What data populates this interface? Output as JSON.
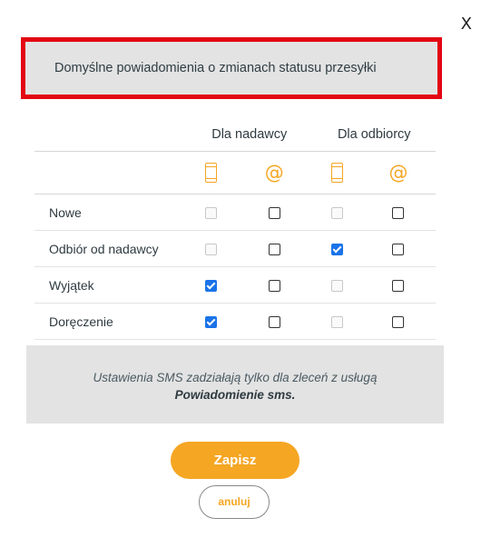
{
  "dialog": {
    "close_label": "X",
    "title": "Domyślne powiadomienia o zmianach statusu przesyłki"
  },
  "table": {
    "groups": [
      {
        "label": "Dla nadawcy"
      },
      {
        "label": "Dla odbiorcy"
      }
    ],
    "channel_icons": [
      "phone-icon",
      "at-icon",
      "phone-icon",
      "at-icon"
    ],
    "at_symbol": "@",
    "rows": [
      {
        "label": "Nowe",
        "states": [
          "disabled",
          "unchecked",
          "disabled",
          "unchecked"
        ]
      },
      {
        "label": "Odbiór od nadawcy",
        "states": [
          "disabled",
          "unchecked",
          "checked",
          "unchecked"
        ]
      },
      {
        "label": "Wyjątek",
        "states": [
          "checked",
          "unchecked",
          "disabled",
          "unchecked"
        ]
      },
      {
        "label": "Doręczenie",
        "states": [
          "checked",
          "unchecked",
          "disabled",
          "unchecked"
        ]
      }
    ]
  },
  "info": {
    "line1": "Ustawienia SMS zadziałają tylko dla zleceń z usługą",
    "line2": "Powiadomienie sms."
  },
  "buttons": {
    "save_label": "Zapisz",
    "cancel_label": "anuluj"
  },
  "colors": {
    "accent": "#f5a623",
    "highlight_border": "#e30613",
    "panel_bg": "#e3e3e3",
    "checkbox_checked": "#1a73e8"
  }
}
